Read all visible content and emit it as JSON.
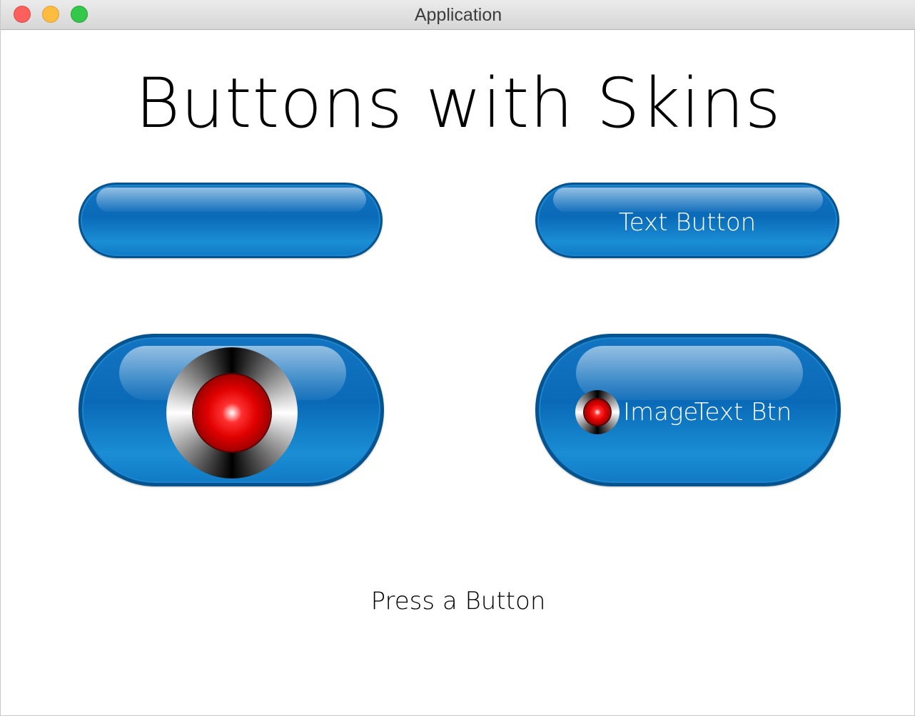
{
  "window": {
    "title": "Application"
  },
  "heading": "Buttons with Skins",
  "buttons": {
    "blank": {
      "label": ""
    },
    "text": {
      "label": "Text Button"
    },
    "image": {
      "icon": "red-orb-icon"
    },
    "image_text": {
      "icon": "red-orb-icon",
      "label": "ImageText Btn"
    }
  },
  "status": "Press a Button",
  "colors": {
    "button_blue": "#0a6ab8",
    "button_border": "#06548f",
    "orb_red": "#e00000"
  }
}
